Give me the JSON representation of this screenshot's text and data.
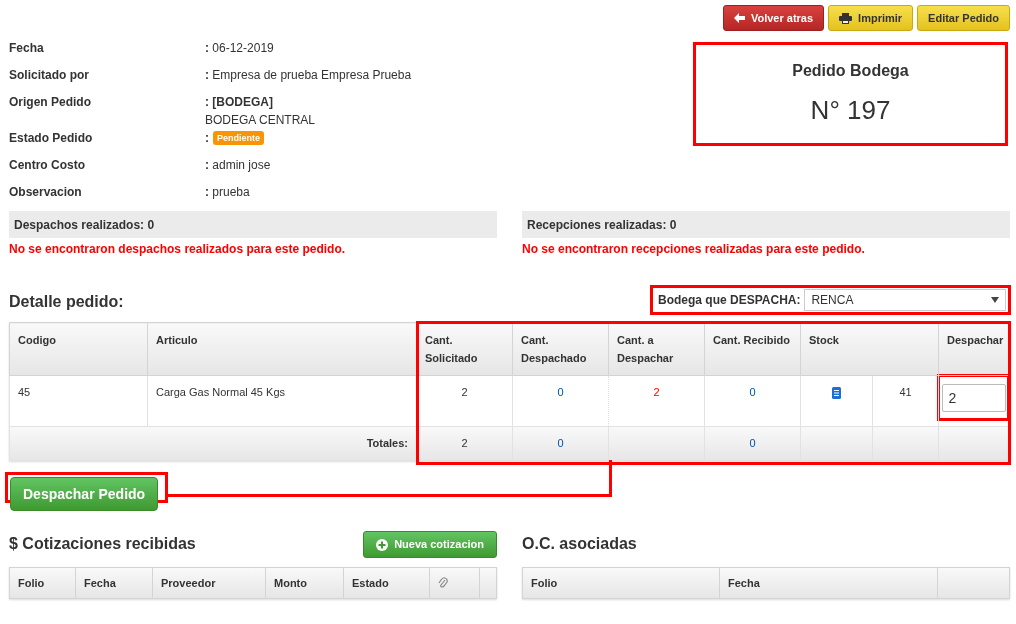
{
  "toolbar": [
    {
      "kind": "back",
      "label": "Volver atras"
    },
    {
      "kind": "print",
      "label": "Imprimir"
    },
    {
      "kind": "edit",
      "label": "Editar Pedido"
    }
  ],
  "info": [
    {
      "label": "Fecha",
      "value": "06-12-2019"
    },
    {
      "label": "Solicitado por",
      "value": "Empresa de prueba Empresa Prueba"
    },
    {
      "label": "Origen Pedido",
      "value": "[BODEGA]",
      "subvalue": "BODEGA CENTRAL"
    },
    {
      "label": "Estado Pedido",
      "badge": "Pendiente"
    },
    {
      "label": "Centro Costo",
      "value": "admin jose"
    },
    {
      "label": "Observacion",
      "value": "prueba"
    }
  ],
  "separator": ":",
  "order_box": {
    "title": "Pedido Bodega",
    "number": "N° 197"
  },
  "panels": [
    {
      "title": "Despachos realizados: 0",
      "message": "No se encontraron despachos realizados para este pedido."
    },
    {
      "title": "Recepciones realizadas: 0",
      "message": "No se encontraron recepciones realizadas para este pedido."
    }
  ],
  "detail": {
    "title": "Detalle pedido:",
    "warehouse_label": "Bodega que DESPACHA:",
    "warehouse_value": "RENCA",
    "columns": [
      "Codigo",
      "Articulo",
      "Cant. Solicitado",
      "Cant. Despachado",
      "Cant. a Despachar",
      "Cant. Recibido",
      "Stock",
      "Despachar"
    ],
    "rows": [
      {
        "codigo": "45",
        "articulo": "Carga Gas Normal 45 Kgs",
        "solicitado": "2",
        "despachado": "0",
        "a_despachar": "2",
        "recibido": "0",
        "stock": "41",
        "despachar": "2"
      }
    ],
    "totals": {
      "label": "Totales:",
      "solicitado": "2",
      "despachado": "0",
      "recibido": "0"
    }
  },
  "dispatch_button": "Despachar Pedido",
  "quotes": {
    "title": "$ Cotizaciones recibidas",
    "new_button": "Nueva cotizacion",
    "columns": [
      "Folio",
      "Fecha",
      "Proveedor",
      "Monto",
      "Estado"
    ]
  },
  "purchase_orders": {
    "title": "O.C. asociadas",
    "columns": [
      "Folio",
      "Fecha"
    ]
  }
}
